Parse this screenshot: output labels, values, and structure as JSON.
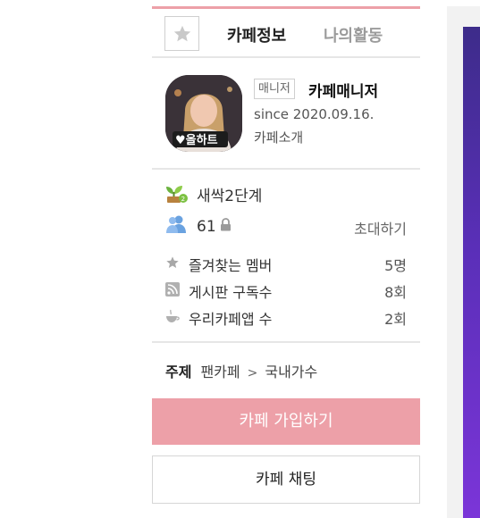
{
  "tabs": {
    "star_label": "☆",
    "active": "카페정보",
    "inactive": "나의활동"
  },
  "profile": {
    "avatar_caption": "♥올하트",
    "manager_badge": "매니저",
    "manager_name": "카페매니저",
    "since": "since 2020.09.16.",
    "intro_link": "카페소개"
  },
  "stats": {
    "level": "새싹2단계",
    "member_count": "61",
    "invite": "초대하기",
    "items": [
      {
        "label": "즐겨찾는 멤버",
        "value": "5명",
        "icon": "star-icon"
      },
      {
        "label": "게시판 구독수",
        "value": "8회",
        "icon": "rss-icon"
      },
      {
        "label": "우리카페앱 수",
        "value": "2회",
        "icon": "cup-icon"
      }
    ]
  },
  "topic": {
    "key": "주제",
    "category": "팬카페",
    "separator": ">",
    "subcategory": "국내가수"
  },
  "buttons": {
    "join": "카페 가입하기",
    "chat": "카페 채팅"
  },
  "colors": {
    "accent_pink": "#eda0a8",
    "right_banner_purple": "#5a2fb8"
  }
}
